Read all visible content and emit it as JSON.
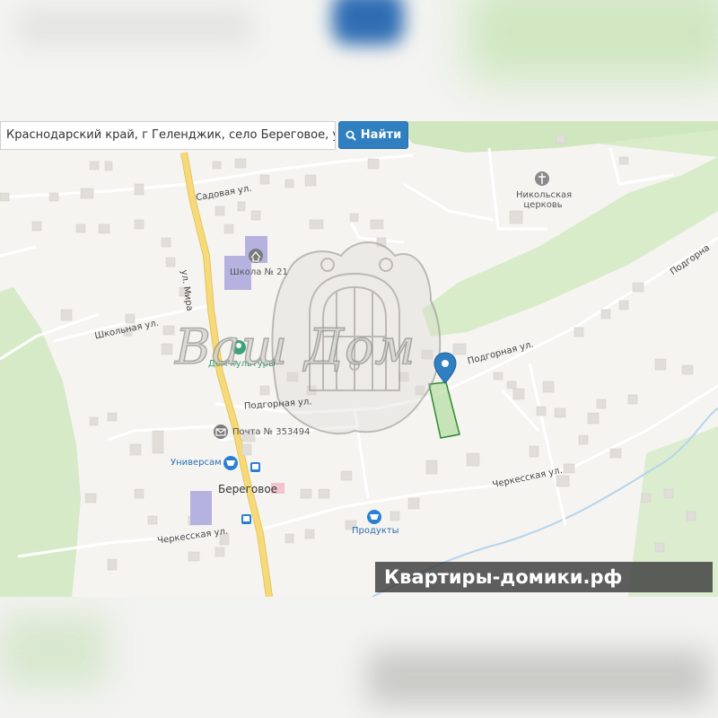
{
  "search": {
    "value": "Краснодарский край, г Геленджик, село Береговое, ул Подг",
    "button_label": "Найти"
  },
  "map": {
    "streets": {
      "sadovaya": "Садовая ул.",
      "mira": "ул. Мира",
      "shkolnaya": "Школьная ул.",
      "podgornaya_left": "Подгорная ул.",
      "podgornaya_right": "Подгорная ул.",
      "podgornaya_top": "Подгорна",
      "cherkesskaya_right": "Черкесская ул.",
      "cherkesskaya_left": "Черкесская ул."
    },
    "pois": {
      "church": "Никольская церковь",
      "church_line1": "Никольская",
      "church_line2": "церковь",
      "school": "Школа № 21",
      "culture": "Дом культуры",
      "post": "Почта № 353494",
      "universam": "Универсам",
      "produkty": "Продукты",
      "village": "Береговое"
    },
    "icons": [
      "search-icon",
      "church-icon",
      "school-icon",
      "culture-icon",
      "post-icon",
      "shop-icon",
      "bus-stop-icon",
      "location-pin-icon"
    ],
    "colors": {
      "road_main": "#f6d97a",
      "forest": "#d8ecc9",
      "button": "#2f7fc1",
      "pin": "#2f7fc1",
      "plot": "#7fc46a"
    }
  },
  "watermark": {
    "text": "Ваш Дом"
  },
  "banner": {
    "text": "Квартиры-домики.рф"
  }
}
